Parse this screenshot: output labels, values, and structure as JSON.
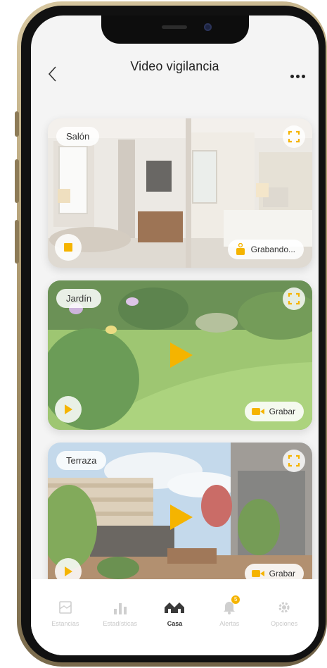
{
  "header": {
    "title": "Video vigilancia"
  },
  "cameras": [
    {
      "name": "Salón",
      "action": "Grabando...",
      "state": "recording"
    },
    {
      "name": "Jardín",
      "action": "Grabar",
      "state": "paused"
    },
    {
      "name": "Terraza",
      "action": "Grabar",
      "state": "paused"
    }
  ],
  "nav": [
    {
      "label": "Estancias",
      "icon": "rooms-icon"
    },
    {
      "label": "Estadísticas",
      "icon": "bar-chart-icon"
    },
    {
      "label": "Casa",
      "icon": "house-icon",
      "active": true
    },
    {
      "label": "Alertas",
      "icon": "bell-icon",
      "badge": "5"
    },
    {
      "label": "Opciones",
      "icon": "gear-icon"
    }
  ],
  "colors": {
    "accent": "#f5b400",
    "background": "#f4f4f4",
    "frame": "#b29c6e"
  }
}
